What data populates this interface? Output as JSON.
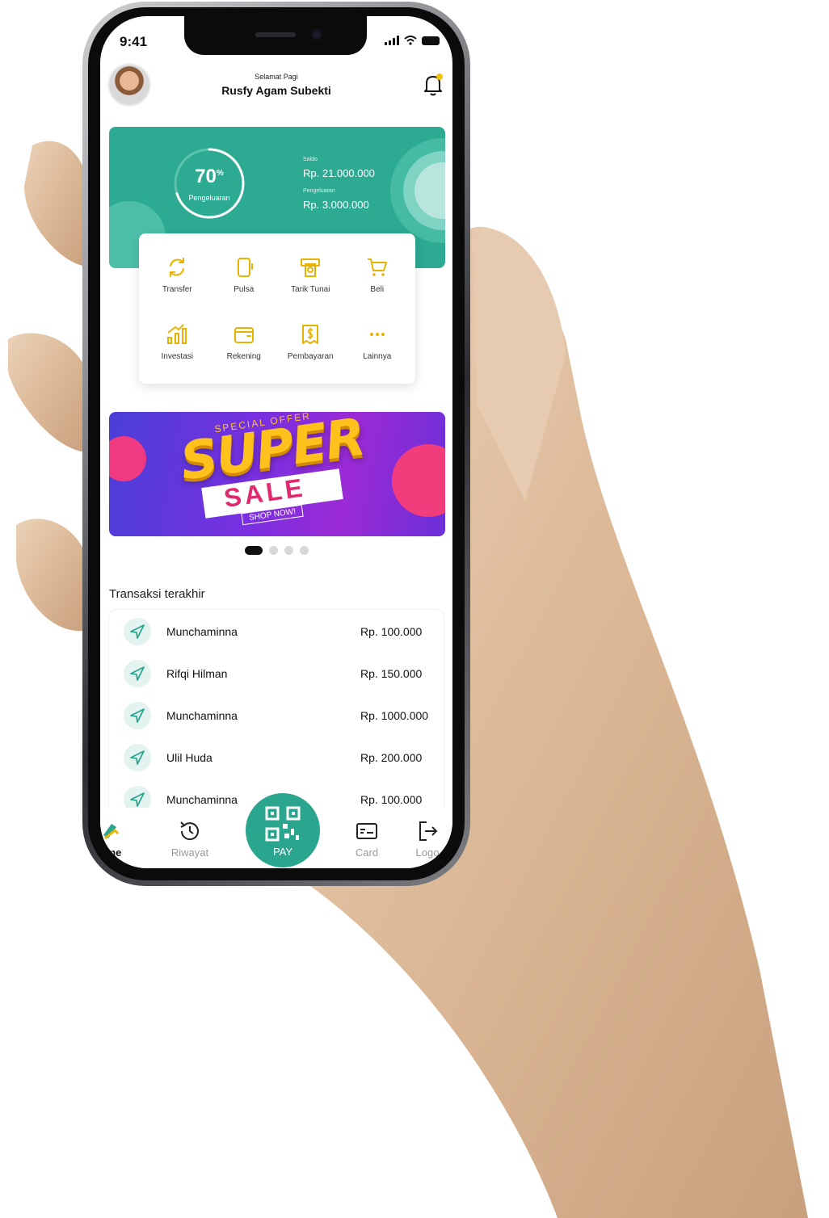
{
  "status_bar": {
    "time": "9:41"
  },
  "header": {
    "greeting": "Selamat Pagi",
    "user_name": "Rusfy Agam Subekti"
  },
  "balance_card": {
    "gauge_value": "70",
    "gauge_unit": "%",
    "gauge_label": "Pengeluaran",
    "gauge_fraction": 0.7,
    "saldo_label": "Saldo",
    "saldo_value": "Rp. 21.000.000",
    "pengeluaran_label": "Pengeluaran",
    "pengeluaran_value": "Rp. 3.000.000",
    "color": "#2daa92"
  },
  "menu": [
    {
      "label": "Transfer",
      "icon": "transfer-icon"
    },
    {
      "label": "Pulsa",
      "icon": "phone-icon"
    },
    {
      "label": "Tarik Tunai",
      "icon": "atm-icon"
    },
    {
      "label": "Beli",
      "icon": "cart-icon"
    },
    {
      "label": "Investasi",
      "icon": "chart-icon"
    },
    {
      "label": "Rekening",
      "icon": "wallet-icon"
    },
    {
      "label": "Pembayaran",
      "icon": "bill-icon"
    },
    {
      "label": "Lainnya",
      "icon": "more-icon"
    }
  ],
  "banner": {
    "offer_text": "SPECIAL OFFER",
    "headline": "SUPER",
    "subline": "SALE",
    "cta": "SHOP NOW!",
    "active_slide": 1,
    "slide_count": 4
  },
  "transactions": {
    "title": "Transaksi terakhir",
    "items": [
      {
        "name": "Munchaminna",
        "amount": "Rp. 100.000"
      },
      {
        "name": "Rifqi Hilman",
        "amount": "Rp. 150.000"
      },
      {
        "name": "Munchaminna",
        "amount": "Rp. 1000.000"
      },
      {
        "name": "Ulil Huda",
        "amount": "Rp. 200.000"
      },
      {
        "name": "Munchaminna",
        "amount": "Rp. 100.000"
      }
    ]
  },
  "bottom_nav": {
    "home": "ome",
    "history": "Riwayat",
    "pay": "PAY",
    "card": "Card",
    "logout": "Logo"
  },
  "colors": {
    "accent": "#2aa68e",
    "icon_gold": "#e7b300"
  }
}
